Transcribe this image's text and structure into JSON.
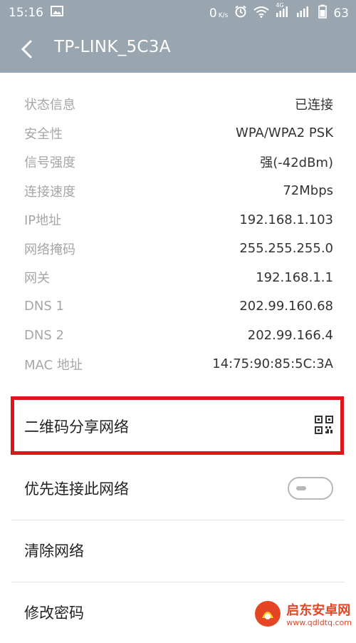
{
  "status_bar": {
    "time": "15:16",
    "net_speed_value": "0",
    "net_speed_unit": "K/s",
    "network_type": "4G",
    "battery": "63"
  },
  "header": {
    "title": "TP-LINK_5C3A"
  },
  "info_rows": [
    {
      "label": "状态信息",
      "value": "已连接"
    },
    {
      "label": "安全性",
      "value": "WPA/WPA2 PSK"
    },
    {
      "label": "信号强度",
      "value": "强(-42dBm)"
    },
    {
      "label": "连接速度",
      "value": "72Mbps"
    },
    {
      "label": "IP地址",
      "value": "192.168.1.103"
    },
    {
      "label": "网络掩码",
      "value": "255.255.255.0"
    },
    {
      "label": "网关",
      "value": "192.168.1.1"
    },
    {
      "label": "DNS 1",
      "value": "202.99.160.68"
    },
    {
      "label": "DNS 2",
      "value": "202.99.166.4"
    },
    {
      "label": "MAC 地址",
      "value": "14:75:90:85:5C:3A"
    }
  ],
  "actions": {
    "qr_share": "二维码分享网络",
    "priority": "优先连接此网络",
    "priority_enabled": false,
    "clear": "清除网络",
    "change_password": "修改密码"
  },
  "watermark": {
    "text": "启东安卓网",
    "url": "www.qdldtq.com"
  },
  "colors": {
    "header": "#9aa6af",
    "highlight": "#e0141b"
  }
}
